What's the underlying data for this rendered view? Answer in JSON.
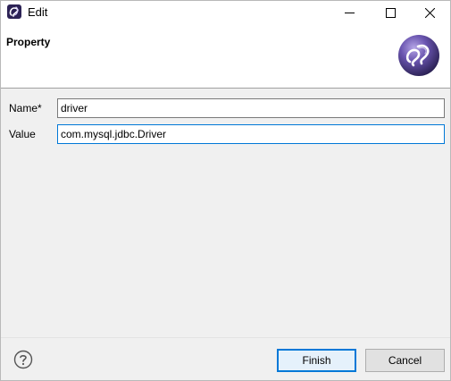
{
  "window": {
    "title": "Edit",
    "icon": "eclipse-app-icon"
  },
  "header": {
    "title": "Property",
    "icon": "eclipse-banner-icon"
  },
  "form": {
    "name_label": "Name*",
    "name_value": "driver",
    "value_label": "Value",
    "value_value": "com.mysql.jdbc.Driver"
  },
  "footer": {
    "help_icon": "help-icon",
    "finish_label": "Finish",
    "cancel_label": "Cancel"
  },
  "colors": {
    "focus_border": "#0078d7",
    "dialog_background": "#f0f0f0",
    "header_background": "#ffffff",
    "eclipse_purple": "#2c2255"
  }
}
